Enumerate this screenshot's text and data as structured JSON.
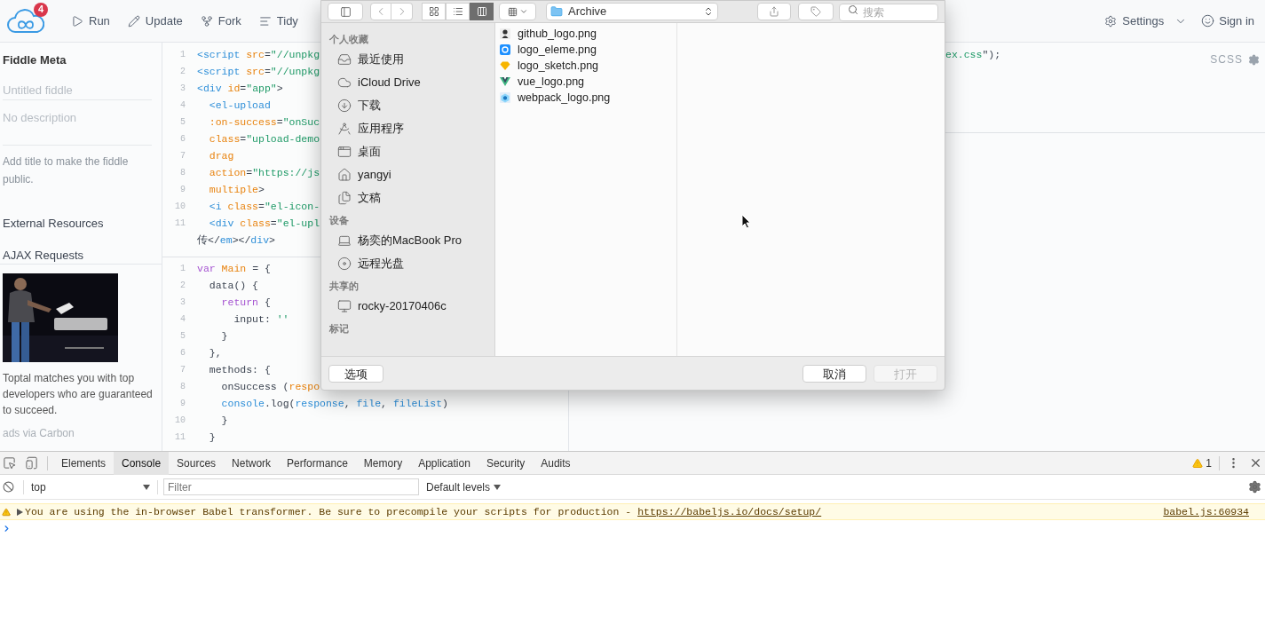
{
  "toolbar": {
    "badge": "4",
    "actions": [
      {
        "label": "Run",
        "kind": "run"
      },
      {
        "label": "Update",
        "kind": "update"
      },
      {
        "label": "Fork",
        "kind": "fork"
      },
      {
        "label": "Tidy",
        "kind": "tidy"
      }
    ],
    "settings": "Settings",
    "sign_in": "Sign in"
  },
  "sidebar": {
    "title": "Fiddle Meta",
    "title_field": {
      "placeholder": "Untitled fiddle"
    },
    "description_field": {
      "placeholder": "No description"
    },
    "hint": "Add title to make the fiddle public.",
    "sections": [
      "External Resources",
      "AJAX Requests"
    ],
    "ad": {
      "text": "Toptal matches you with top developers who are guaranteed to succeed.",
      "credit": "ads via Carbon"
    }
  },
  "html_editor": {
    "lines": [
      {
        "number": "1",
        "tokens": [
          {
            "kind": "tag",
            "text": "<script"
          },
          {
            "kind": "attr",
            "text": " src"
          },
          {
            "kind": "plain",
            "text": "="
          },
          {
            "kind": "string",
            "text": "\"//unpkg"
          }
        ]
      },
      {
        "number": "2",
        "tokens": [
          {
            "kind": "tag",
            "text": "<script"
          },
          {
            "kind": "attr",
            "text": " src"
          },
          {
            "kind": "plain",
            "text": "="
          },
          {
            "kind": "string",
            "text": "\"//unpkg"
          }
        ]
      },
      {
        "number": "3",
        "tokens": [
          {
            "kind": "tag",
            "text": "<div"
          },
          {
            "kind": "attr",
            "text": " id"
          },
          {
            "kind": "plain",
            "text": "="
          },
          {
            "kind": "string",
            "text": "\"app\""
          },
          {
            "kind": "plain",
            "text": ">"
          }
        ]
      },
      {
        "number": "4",
        "tokens": [
          {
            "kind": "tag",
            "text": "  <el-upload"
          }
        ]
      },
      {
        "number": "5",
        "tokens": [
          {
            "kind": "attr",
            "text": "  :on-success"
          },
          {
            "kind": "plain",
            "text": "="
          },
          {
            "kind": "string",
            "text": "\"onSuc"
          }
        ]
      },
      {
        "number": "6",
        "tokens": [
          {
            "kind": "attr",
            "text": "  class"
          },
          {
            "kind": "plain",
            "text": "="
          },
          {
            "kind": "string",
            "text": "\"upload-demo"
          }
        ]
      },
      {
        "number": "7",
        "tokens": [
          {
            "kind": "attr",
            "text": "  drag"
          }
        ]
      },
      {
        "number": "8",
        "tokens": [
          {
            "kind": "attr",
            "text": "  action"
          },
          {
            "kind": "plain",
            "text": "="
          },
          {
            "kind": "string",
            "text": "\"https://js"
          }
        ]
      },
      {
        "number": "9",
        "tokens": [
          {
            "kind": "attr",
            "text": "  multiple"
          },
          {
            "kind": "plain",
            "text": ">"
          }
        ]
      },
      {
        "number": "10",
        "tokens": [
          {
            "kind": "tag",
            "text": "  <i"
          },
          {
            "kind": "attr",
            "text": " class"
          },
          {
            "kind": "plain",
            "text": "="
          },
          {
            "kind": "string",
            "text": "\"el-icon-"
          }
        ]
      },
      {
        "number": "11",
        "tokens": [
          {
            "kind": "tag",
            "text": "  <div"
          },
          {
            "kind": "attr",
            "text": " class"
          },
          {
            "kind": "plain",
            "text": "="
          },
          {
            "kind": "string",
            "text": "\"el-upl"
          }
        ],
        "wrap": [
          {
            "kind": "plain",
            "text": "传</"
          },
          {
            "kind": "tag",
            "text": "em"
          },
          {
            "kind": "plain",
            "text": "></"
          },
          {
            "kind": "tag",
            "text": "div"
          },
          {
            "kind": "plain",
            "text": ">"
          }
        ]
      }
    ]
  },
  "js_editor": {
    "lines": [
      {
        "number": "1",
        "tokens": [
          {
            "kind": "keyword",
            "text": "var"
          },
          {
            "kind": "attr",
            "text": " Main"
          },
          {
            "kind": "plain",
            "text": " = {"
          }
        ]
      },
      {
        "number": "2",
        "tokens": [
          {
            "kind": "plain",
            "text": "  data() {"
          }
        ]
      },
      {
        "number": "3",
        "tokens": [
          {
            "kind": "keyword",
            "text": "    return"
          },
          {
            "kind": "plain",
            "text": " {"
          }
        ]
      },
      {
        "number": "4",
        "tokens": [
          {
            "kind": "plain",
            "text": "      input: "
          },
          {
            "kind": "string",
            "text": "''"
          }
        ]
      },
      {
        "number": "5",
        "tokens": [
          {
            "kind": "plain",
            "text": "    }"
          }
        ]
      },
      {
        "number": "6",
        "tokens": [
          {
            "kind": "plain",
            "text": "  },"
          }
        ]
      },
      {
        "number": "7",
        "tokens": [
          {
            "kind": "plain",
            "text": "  methods: {"
          }
        ]
      },
      {
        "number": "8",
        "tokens": [
          {
            "kind": "plain",
            "text": "    onSuccess ("
          },
          {
            "kind": "attr",
            "text": "respo"
          }
        ]
      },
      {
        "number": "9",
        "tokens": [
          {
            "kind": "tag",
            "text": "    console"
          },
          {
            "kind": "plain",
            "text": ".log("
          },
          {
            "kind": "tag",
            "text": "response"
          },
          {
            "kind": "plain",
            "text": ", "
          },
          {
            "kind": "tag",
            "text": "file"
          },
          {
            "kind": "plain",
            "text": ", "
          },
          {
            "kind": "tag",
            "text": "fileList"
          },
          {
            "kind": "plain",
            "text": ")"
          }
        ]
      },
      {
        "number": "10",
        "tokens": [
          {
            "kind": "plain",
            "text": "    }"
          }
        ]
      },
      {
        "number": "11",
        "tokens": [
          {
            "kind": "plain",
            "text": "  }"
          }
        ]
      }
    ]
  },
  "css_editor": {
    "language": "SCSS",
    "lines": [
      {
        "tokens": [
          {
            "kind": "string",
            "text": "ex.css"
          },
          {
            "kind": "plain",
            "text": "\");"
          }
        ]
      }
    ]
  },
  "file_dialog": {
    "view_modes": [
      {
        "kind": "icons",
        "selected": false
      },
      {
        "kind": "list",
        "selected": false
      },
      {
        "kind": "columns",
        "selected": true
      }
    ],
    "location": "Archive",
    "search": {
      "placeholder": "搜索"
    },
    "sidebar": [
      {
        "heading": "个人收藏",
        "items": [
          {
            "label": "最近使用",
            "kind": "recents"
          },
          {
            "label": "iCloud Drive",
            "kind": "cloud"
          },
          {
            "label": "下载",
            "kind": "downloads"
          },
          {
            "label": "应用程序",
            "kind": "apps"
          },
          {
            "label": "桌面",
            "kind": "desktop"
          },
          {
            "label": "yangyi",
            "kind": "home"
          },
          {
            "label": "文稿",
            "kind": "documents"
          }
        ]
      },
      {
        "heading": "设备",
        "items": [
          {
            "label": "杨奕的MacBook Pro",
            "kind": "laptop"
          },
          {
            "label": "远程光盘",
            "kind": "disc"
          }
        ]
      },
      {
        "heading": "共享的",
        "items": [
          {
            "label": "rocky-20170406c",
            "kind": "computer"
          }
        ]
      },
      {
        "heading": "标记"
      }
    ],
    "files": [
      {
        "name": "github_logo.png",
        "kind": "figure"
      },
      {
        "name": "logo_eleme.png",
        "kind": "tile"
      },
      {
        "name": "logo_sketch.png",
        "kind": "diamond"
      },
      {
        "name": "vue_logo.png",
        "kind": "vee"
      },
      {
        "name": "webpack_logo.png",
        "kind": "cube"
      }
    ],
    "options_button": "选项",
    "cancel_button": "取消",
    "open_button": {
      "label": "打开",
      "disabled": true
    }
  },
  "devtools": {
    "tabs": [
      {
        "label": "Elements",
        "selected": false
      },
      {
        "label": "Console",
        "selected": true
      },
      {
        "label": "Sources",
        "selected": false
      },
      {
        "label": "Network",
        "selected": false
      },
      {
        "label": "Performance",
        "selected": false
      },
      {
        "label": "Memory",
        "selected": false
      },
      {
        "label": "Application",
        "selected": false
      },
      {
        "label": "Security",
        "selected": false
      },
      {
        "label": "Audits",
        "selected": false
      }
    ],
    "warning_count": "1",
    "context": "top",
    "filter": {
      "placeholder": "Filter"
    },
    "levels": "Default levels",
    "messages": [
      {
        "kind": "warning",
        "text": "You are using the in-browser Babel transformer. Be sure to precompile your scripts for production - ",
        "link": "https://babeljs.io/docs/setup/",
        "source": "babel.js:60934"
      }
    ]
  }
}
